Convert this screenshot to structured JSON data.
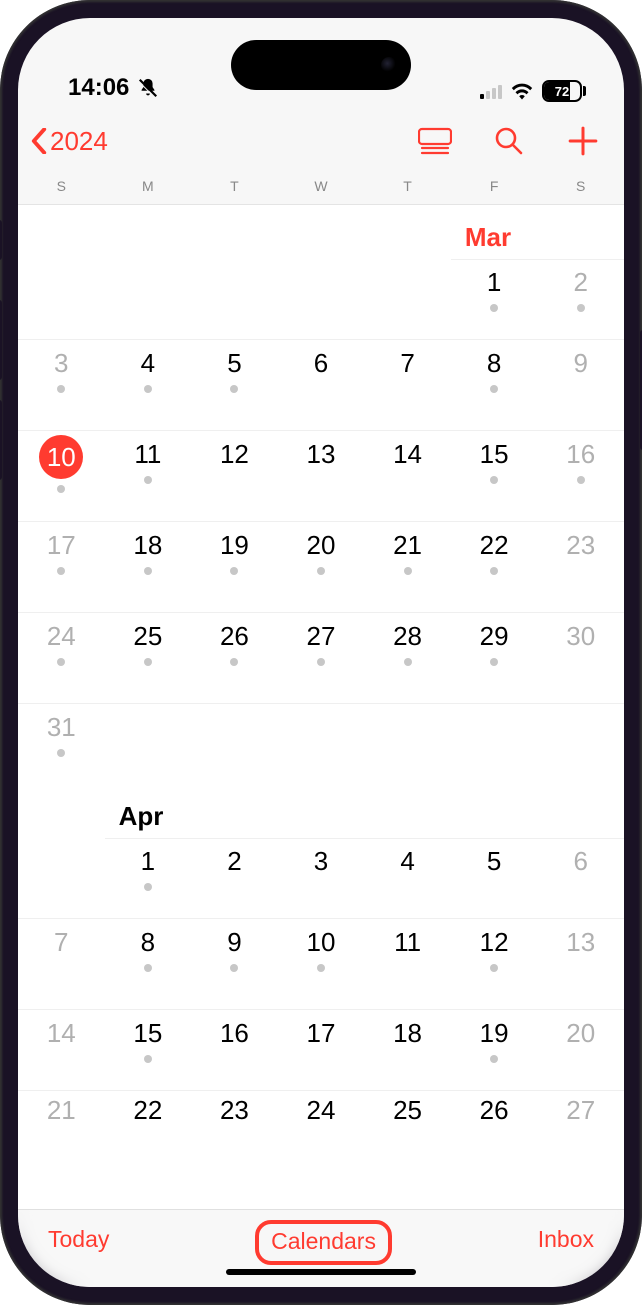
{
  "status": {
    "time": "14:06",
    "battery": "72"
  },
  "nav": {
    "year": "2024"
  },
  "weekdays": [
    "S",
    "M",
    "T",
    "W",
    "T",
    "F",
    "S"
  ],
  "months": {
    "mar": "Mar",
    "apr": "Apr"
  },
  "days": {
    "mar": {
      "r0": [
        "",
        "",
        "",
        "",
        "",
        "1",
        "2"
      ],
      "r0_dots": [
        false,
        false,
        false,
        false,
        false,
        true,
        true
      ],
      "r1": [
        "3",
        "4",
        "5",
        "6",
        "7",
        "8",
        "9"
      ],
      "r1_dots": [
        true,
        true,
        true,
        false,
        false,
        true,
        false
      ],
      "r2": [
        "10",
        "11",
        "12",
        "13",
        "14",
        "15",
        "16"
      ],
      "r2_dots": [
        true,
        true,
        false,
        false,
        false,
        true,
        true
      ],
      "r2_today": 0,
      "r3": [
        "17",
        "18",
        "19",
        "20",
        "21",
        "22",
        "23"
      ],
      "r3_dots": [
        true,
        true,
        true,
        true,
        true,
        true,
        false
      ],
      "r4": [
        "24",
        "25",
        "26",
        "27",
        "28",
        "29",
        "30"
      ],
      "r4_dots": [
        true,
        true,
        true,
        true,
        true,
        true,
        false
      ],
      "r5": [
        "31",
        "",
        "",
        "",
        "",
        "",
        ""
      ],
      "r5_dots": [
        true,
        false,
        false,
        false,
        false,
        false,
        false
      ]
    },
    "apr": {
      "r0": [
        "",
        "1",
        "2",
        "3",
        "4",
        "5",
        "6"
      ],
      "r0_dots": [
        false,
        true,
        false,
        false,
        false,
        false,
        false
      ],
      "r1": [
        "7",
        "8",
        "9",
        "10",
        "11",
        "12",
        "13"
      ],
      "r1_dots": [
        false,
        true,
        true,
        true,
        false,
        true,
        false
      ],
      "r2": [
        "14",
        "15",
        "16",
        "17",
        "18",
        "19",
        "20"
      ],
      "r2_dots": [
        false,
        true,
        false,
        false,
        false,
        true,
        false
      ],
      "r3": [
        "21",
        "22",
        "23",
        "24",
        "25",
        "26",
        "27"
      ]
    }
  },
  "bottom": {
    "today": "Today",
    "calendars": "Calendars",
    "inbox": "Inbox"
  }
}
